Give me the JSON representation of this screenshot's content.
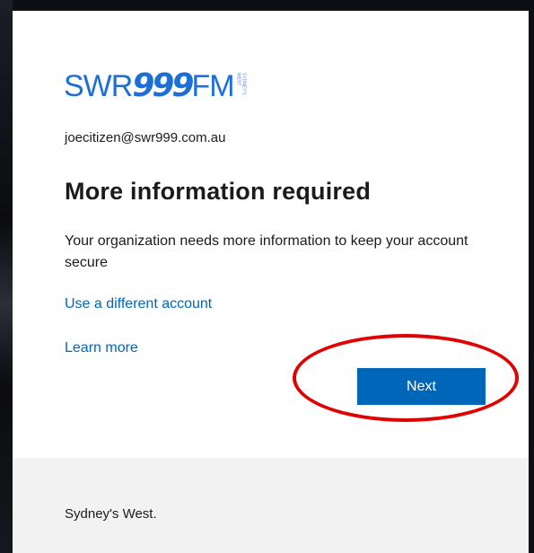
{
  "logo": {
    "prefix": "SWR",
    "numerals": "999",
    "suffix": "FM",
    "tagline": "SYDNEY'S WEST",
    "brand_color": "#1d6fd6"
  },
  "account": {
    "email": "joecitizen@swr999.com.au"
  },
  "main": {
    "title": "More information required",
    "description": "Your organization needs more information to keep your account secure",
    "use_different_account": "Use a different account",
    "learn_more": "Learn more",
    "next_label": "Next"
  },
  "footer": {
    "text": "Sydney's West."
  },
  "colors": {
    "link": "#0067b8",
    "primary_button": "#0067b8",
    "annotation": "#e00000",
    "footer_bg": "#f2f2f2"
  }
}
